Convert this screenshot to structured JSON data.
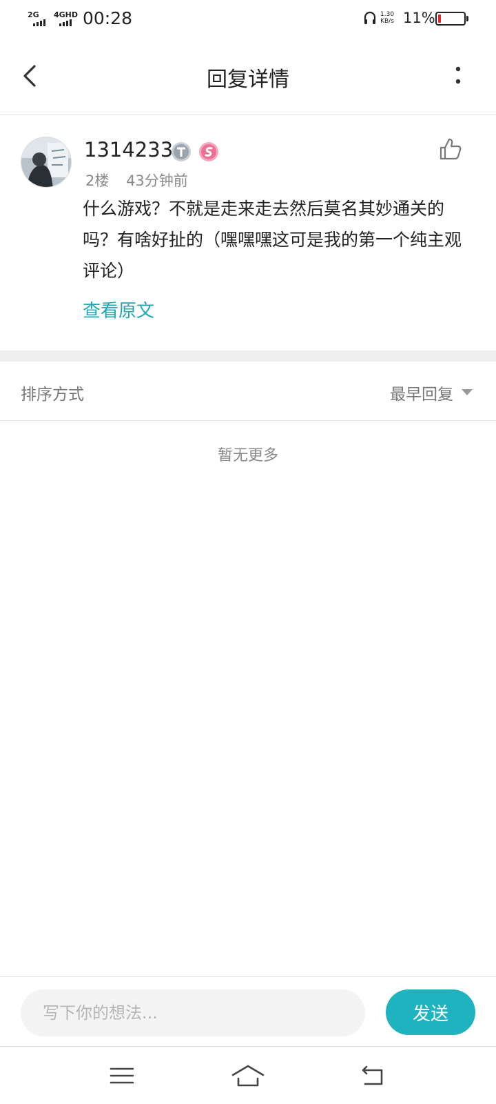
{
  "status_bar": {
    "signal1": "2G",
    "signal2": "4GHD",
    "time": "00:28",
    "net_speed_value": "1.30",
    "net_speed_unit": "KB/s",
    "battery_percent": "11%",
    "battery_level": 0.11,
    "battery_color": "#e8252a"
  },
  "header": {
    "title": "回复详情"
  },
  "comment": {
    "username": "1314233",
    "floor": "2楼",
    "time_ago": "43分钟前",
    "text": "什么游戏？不就是走来走去然后莫名其妙通关的吗？有啥好扯的（嘿嘿嘿这可是我的第一个纯主观评论）",
    "view_original": "查看原文"
  },
  "sort": {
    "label": "排序方式",
    "selected": "最早回复"
  },
  "replies": {
    "empty_text": "暂无更多"
  },
  "input_bar": {
    "placeholder": "写下你的想法...",
    "send_label": "发送"
  },
  "colors": {
    "accent": "#1fb3c0",
    "link": "#1ba9b6"
  }
}
